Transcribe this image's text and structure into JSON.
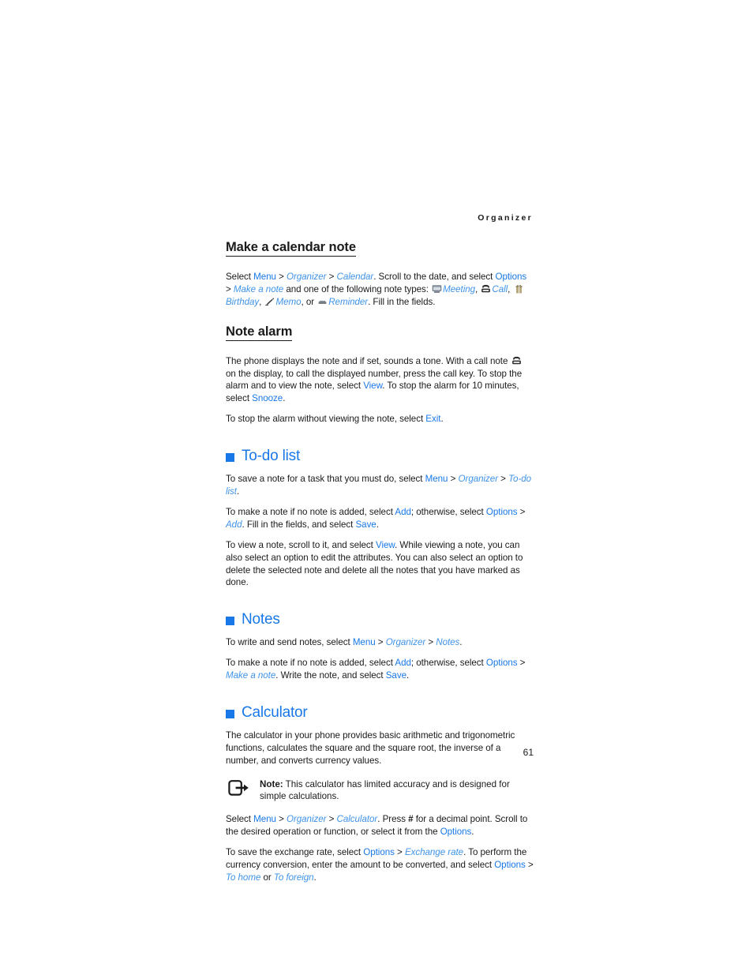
{
  "page": {
    "running_head": "Organizer",
    "folio": "61",
    "accent_blue": "#1878e8",
    "nav_blue": "#3f93e8",
    "text_black": "#1a1a1a"
  },
  "sections": {
    "make_calendar_note": {
      "heading": "Make a calendar note",
      "p1": {
        "a": "Select ",
        "menu": "Menu",
        "gt1": " > ",
        "organizer": "Organizer",
        "gt2": " > ",
        "calendar": "Calendar",
        "b": ". Scroll to the date, and select ",
        "options": "Options",
        "gt3": " > ",
        "make_a_note": "Make a note",
        "c": " and one of the following note types: ",
        "meeting": "Meeting",
        "comma1": ", ",
        "call": "Call",
        "comma2": ", ",
        "birthday": "Birthday",
        "comma3": ", ",
        "memo": "Memo",
        "or": ", or ",
        "reminder": "Reminder",
        "d": ". Fill in the fields."
      }
    },
    "note_alarm": {
      "heading": "Note alarm",
      "p1": {
        "a": "The phone displays the note and if set, sounds a tone. With a call note ",
        "b": " on the display, to call the displayed number, press the call key. To stop the alarm and to view the note, select ",
        "view": "View",
        "c": ". To stop the alarm for 10 minutes, select ",
        "snooze": "Snooze",
        "d": "."
      },
      "p2": {
        "a": "To stop the alarm without viewing the note, select ",
        "exit": "Exit",
        "b": "."
      }
    },
    "todo_list": {
      "heading": "To-do list",
      "p1": {
        "a": "To save a note for a task that you must do, select ",
        "menu": "Menu",
        "gt1": " > ",
        "organizer": "Organizer",
        "gt2": " > ",
        "todo": "To-do list",
        "b": "."
      },
      "p2": {
        "a": "To make a note if no note is added, select ",
        "add1": "Add",
        "b": "; otherwise, select ",
        "options": "Options",
        "gt1": " > ",
        "add2": "Add",
        "c": ". Fill in the fields, and select ",
        "save": "Save",
        "d": "."
      },
      "p3": {
        "a": "To view a note, scroll to it, and select ",
        "view": "View",
        "b": ". While viewing a note, you can also select an option to edit the attributes. You can also select an option to delete the selected note and delete all the notes that you have marked as done."
      }
    },
    "notes": {
      "heading": "Notes",
      "p1": {
        "a": "To write and send notes, select ",
        "menu": "Menu",
        "gt1": " > ",
        "organizer": "Organizer",
        "gt2": " > ",
        "notes": "Notes",
        "b": "."
      },
      "p2": {
        "a": "To make a note if no note is added, select ",
        "add": "Add",
        "b": "; otherwise, select ",
        "options": "Options",
        "gt1": " > ",
        "make_a_note": "Make a note",
        "c": ". Write the note, and select ",
        "save": "Save",
        "d": "."
      }
    },
    "calculator": {
      "heading": "Calculator",
      "p1": "The calculator in your phone provides basic arithmetic and trigonometric functions, calculates the square and the square root, the inverse of a number, and converts currency values.",
      "note": {
        "label": "Note:",
        "text": " This calculator has limited accuracy and is designed for simple calculations."
      },
      "p2": {
        "a": "Select ",
        "menu": "Menu",
        "gt1": " > ",
        "organizer": "Organizer",
        "gt2": " > ",
        "calculator": "Calculator",
        "b": ". Press ",
        "hash": "#",
        "c": " for a decimal point. Scroll to the desired operation or function, or select it from the ",
        "options": "Options",
        "d": "."
      },
      "p3": {
        "a": "To save the exchange rate, select ",
        "options1": "Options",
        "gt1": " > ",
        "exchange_rate": "Exchange rate",
        "b": ". To perform the currency conversion, enter the amount to be converted, and select ",
        "options2": "Options",
        "gt2": " > ",
        "to_home": "To home",
        "c": " or ",
        "to_foreign": "To foreign",
        "d": "."
      }
    }
  },
  "icons": {
    "meeting": "meeting-screen-icon",
    "call": "telephone-icon",
    "birthday": "gift-box-icon",
    "memo": "pen-memo-icon",
    "reminder": "reminder-bar-icon",
    "call_note": "telephone-icon",
    "note_callout": "note-arrow-icon"
  }
}
